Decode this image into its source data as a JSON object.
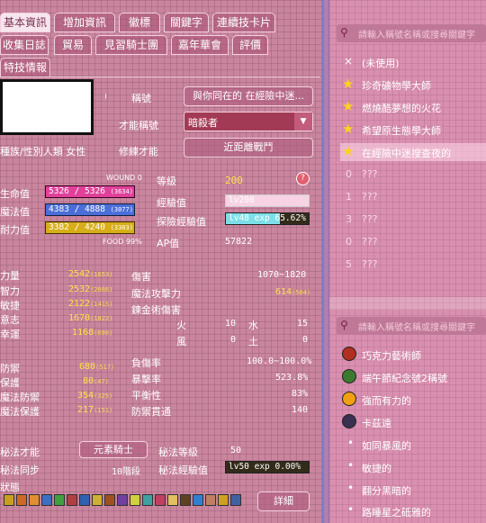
{
  "tabs": {
    "basic": "基本資訊",
    "extra": "增加資訊",
    "emblem": "徽標",
    "keyword": "關鍵字",
    "chain": "連續技卡片",
    "collect": "收集日誌",
    "trade": "貿易",
    "knights": "見習騎士團",
    "carnival": "嘉年華會",
    "eval": "評價",
    "special": "特技情報"
  },
  "profile": {
    "title_label": "稱號",
    "title_value": "與你同在的 在經險中迷...",
    "talent_label": "才能稱號",
    "talent_value": "暗殺者",
    "race_line": "種族/性別人類 女性",
    "mastery_label": "修練才能",
    "mastery_value": "近距離戰鬥"
  },
  "stats": {
    "hp_label": "生命值",
    "hp_value": "5326 / 5326",
    "hp_small": "(3634)",
    "mp_label": "魔法值",
    "mp_value": "4383 / 4888",
    "mp_small": "(3077)",
    "sp_label": "耐力值",
    "sp_value": "3382 / 4240",
    "sp_small": "(3303)",
    "wound": "WOUND 0",
    "food": "FOOD 99%",
    "level_label": "等級",
    "level_value": "200",
    "exp_label": "經驗值",
    "exp_value": "lv200",
    "adv_label": "探險經驗值",
    "adv_value": "lv48 exp 65.62%",
    "ap_label": "AP值",
    "ap_value": "57822",
    "str_label": "力量",
    "str_value": "2542",
    "str_small": "(1653)",
    "int_label": "智力",
    "int_value": "2532",
    "int_small": "(2086)",
    "dex_label": "敏捷",
    "dex_value": "2122",
    "dex_small": "(1415)",
    "will_label": "意志",
    "will_value": "1670",
    "will_small": "(1822)",
    "luck_label": "幸運",
    "luck_value": "1168",
    "luck_small": "(690)",
    "dmg_label": "傷害",
    "dmg_value": "1070~1820",
    "matk_label": "魔法攻擊力",
    "matk_value": "614",
    "matk_small": "(504)",
    "alch_label": "鍊金術傷害",
    "fire": "火",
    "fire_v": "10",
    "water": "水",
    "water_v": "15",
    "wind": "風",
    "wind_v": "0",
    "earth": "土",
    "earth_v": "0",
    "def_label": "防禦",
    "def_value": "680",
    "def_small": "(517)",
    "prot_label": "保護",
    "prot_value": "80",
    "prot_small": "(47)",
    "mdef_label": "魔法防禦",
    "mdef_value": "354",
    "mdef_small": "(325)",
    "mprot_label": "魔法保護",
    "mprot_value": "217",
    "mprot_small": "(151)",
    "injury_label": "負傷率",
    "injury_value": "100.0~100.0%",
    "crit_label": "暴擊率",
    "crit_value": "523.8%",
    "bal_label": "平衡性",
    "bal_value": "83%",
    "pierce_label": "防禦貫通",
    "pierce_value": "140",
    "secret_talent_label": "秘法才能",
    "secret_talent_value": "元素騎士",
    "secret_level_label": "秘法等級",
    "secret_level_value": "50",
    "secret_sync_label": "秘法同步",
    "secret_sync_value": "10階段",
    "secret_exp_label": "秘法經驗值",
    "secret_exp_value": "lv50 exp 0.00%",
    "status_label": "狀態",
    "detail_button": "詳細"
  },
  "progress": {
    "adv_exp": 0.6562
  },
  "right": {
    "search_placeholder": "請輸入稱號名稱或搜尋關鍵字",
    "unused": "(未使用)",
    "titles": [
      "珍奇礦物學大師",
      "燃燒酷夢想的火花",
      "希望原生態學大師",
      "在經險中迷搜查夜的"
    ],
    "numbered": [
      {
        "n": "0",
        "t": "???"
      },
      {
        "n": "1",
        "t": "???"
      },
      {
        "n": "3",
        "t": "???"
      },
      {
        "n": "0",
        "t": "???"
      },
      {
        "n": "5",
        "t": "???"
      }
    ],
    "search2_placeholder": "請輸入稱號名稱或搜尋關鍵字",
    "titles2": [
      "巧克力藝術師",
      "端午節紀念號2稱號",
      "強而有力的",
      "卡茲遠"
    ],
    "bullets": [
      "如同暴風的",
      "敏捷的",
      "翻分黑暗的",
      "路睡星之砥雅的"
    ]
  }
}
